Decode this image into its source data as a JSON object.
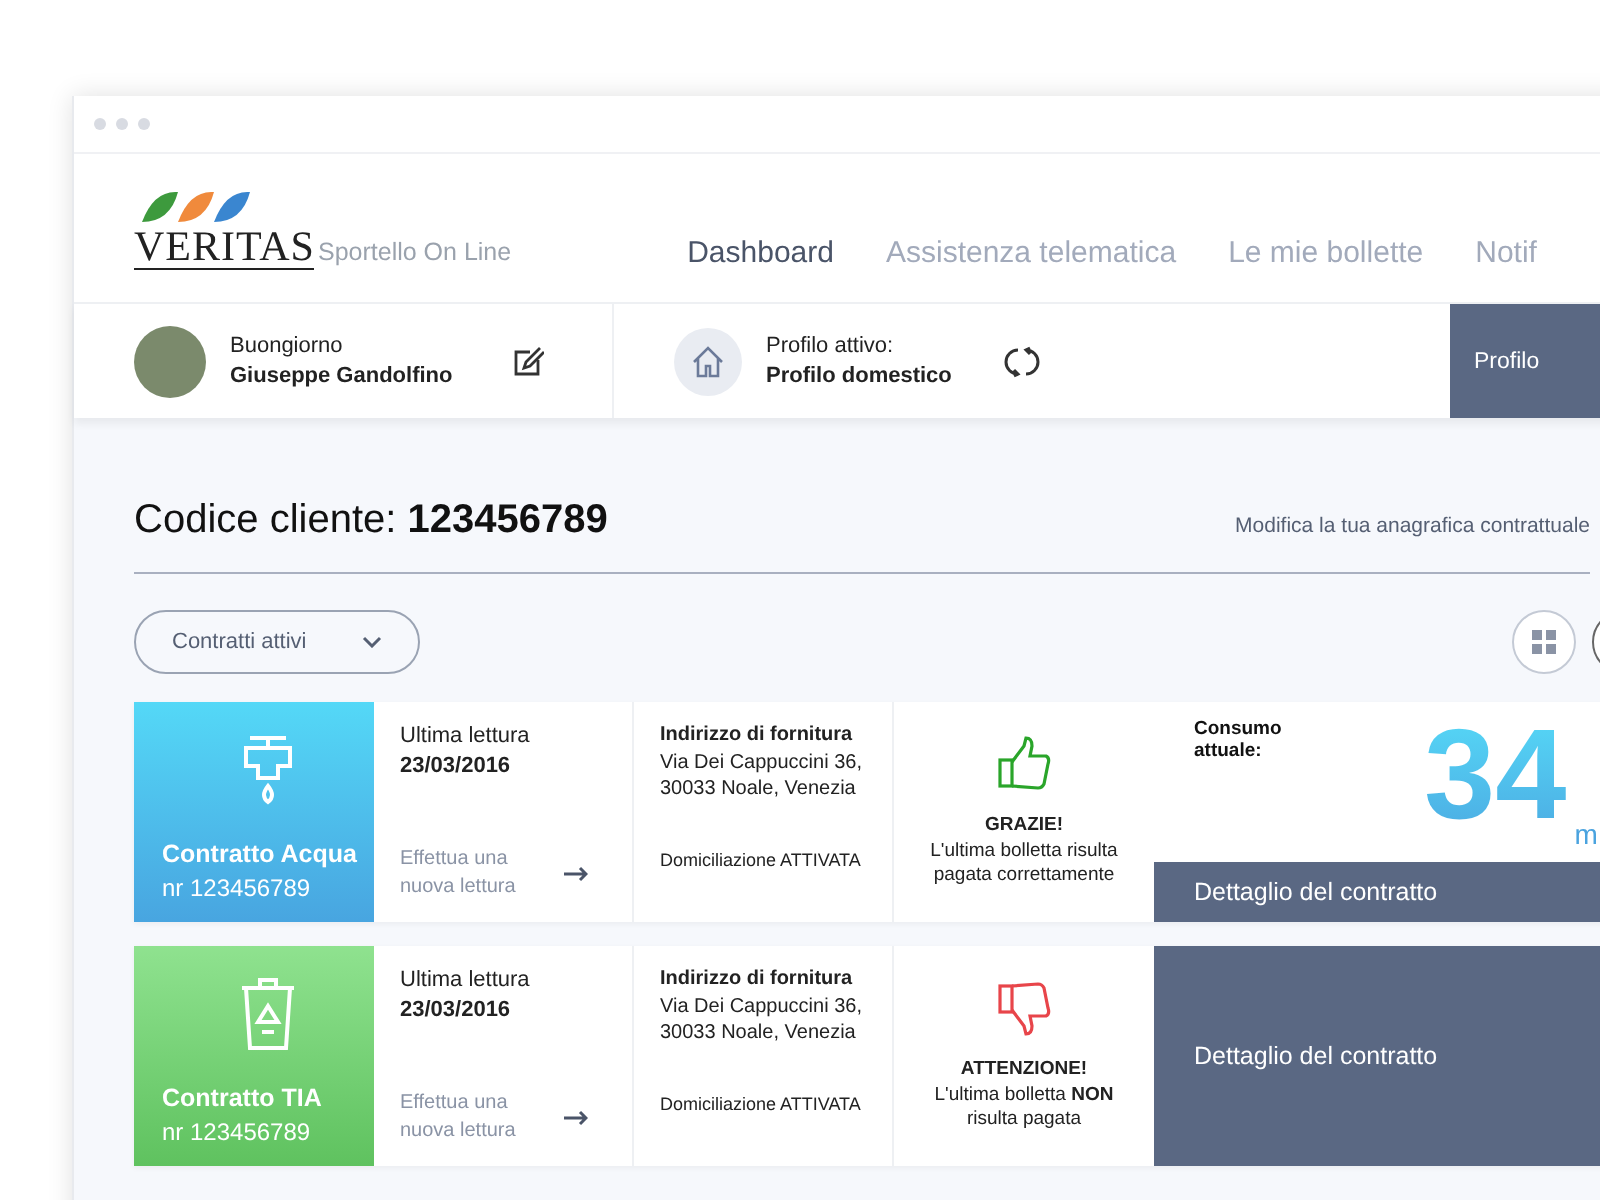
{
  "header": {
    "logo": "VERITAS",
    "subtitle": "Sportello On Line",
    "nav": [
      {
        "label": "Dashboard",
        "selected": true
      },
      {
        "label": "Assistenza telematica",
        "selected": false
      },
      {
        "label": "Le mie bollette",
        "selected": false
      },
      {
        "label": "Notif",
        "selected": false
      }
    ]
  },
  "user_bar": {
    "greeting": "Buongiorno",
    "name": "Giuseppe Gandolfino",
    "profile_label": "Profilo attivo:",
    "profile_value": "Profilo domestico",
    "profile_tab": "Profilo"
  },
  "client": {
    "label": "Codice cliente:",
    "code": "123456789",
    "edit_link": "Modifica la tua anagrafica contrattuale"
  },
  "filter": {
    "label": "Contratti attivi"
  },
  "contracts": [
    {
      "kind": "water",
      "title": "Contratto Acqua",
      "number": "nr 123456789",
      "reading_label": "Ultima lettura",
      "reading_date": "23/03/2016",
      "action": "Effettua una nuova lettura",
      "address_label": "Indirizzo di fornitura",
      "address": "Via Dei Cappuccini 36, 30033 Noale, Venezia",
      "direct_debit": "Domiciliazione ATTIVATA",
      "payment": {
        "paid": true,
        "title": "GRAZIE!",
        "message": "L'ultima bolletta risulta pagata correttamente"
      },
      "consumption": {
        "label": "Consumo attuale:",
        "value": "34",
        "unit": "m"
      },
      "detail": "Dettaglio del contratto"
    },
    {
      "kind": "waste",
      "title": "Contratto TIA",
      "number": "nr 123456789",
      "reading_label": "Ultima lettura",
      "reading_date": "23/03/2016",
      "action": "Effettua una nuova lettura",
      "address_label": "Indirizzo di fornitura",
      "address": "Via Dei Cappuccini 36, 30033 Noale, Venezia",
      "direct_debit": "Domiciliazione ATTIVATA",
      "payment": {
        "paid": false,
        "title": "ATTENZIONE!",
        "message": "L'ultima bolletta **NON** risulta pagata"
      },
      "detail": "Dettaglio del contratto"
    }
  ]
}
